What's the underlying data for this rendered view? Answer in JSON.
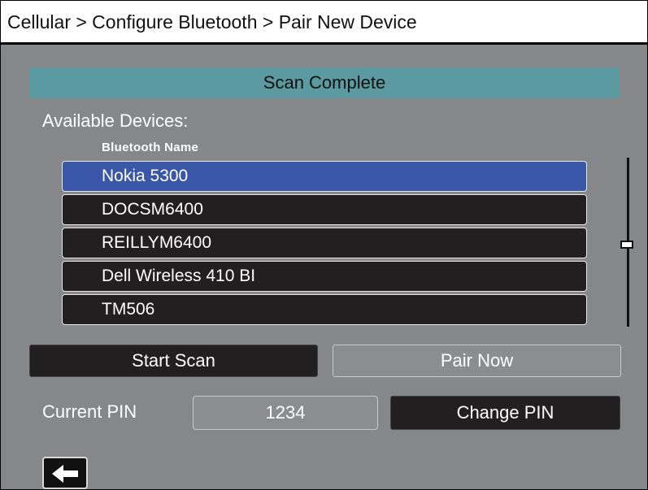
{
  "header": {
    "breadcrumb": "Cellular > Configure Bluetooth > Pair New Device"
  },
  "status": {
    "text": "Scan Complete",
    "color": "#5b9aa0"
  },
  "devices": {
    "section_label": "Available Devices:",
    "column_header": "Bluetooth Name",
    "items": [
      {
        "label": "Nokia 5300",
        "selected": true
      },
      {
        "label": "DOCSM6400",
        "selected": false
      },
      {
        "label": "REILLYM6400",
        "selected": false
      },
      {
        "label": "Dell Wireless 410 BI",
        "selected": false
      },
      {
        "label": "TM506",
        "selected": false
      }
    ],
    "selected_color": "#3a56a8"
  },
  "actions": {
    "start_scan_label": "Start Scan",
    "pair_now_label": "Pair Now"
  },
  "pin": {
    "label": "Current PIN",
    "value": "1234",
    "change_label": "Change PIN"
  },
  "nav": {
    "back_icon": "left-arrow-icon"
  }
}
